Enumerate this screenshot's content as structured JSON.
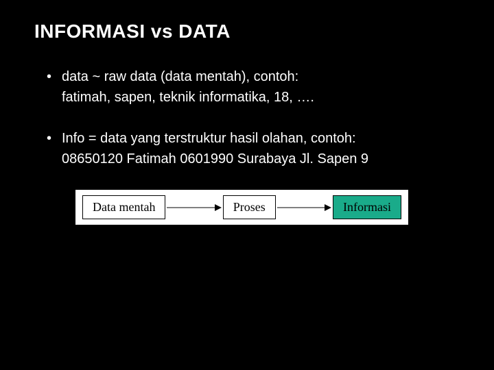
{
  "slide": {
    "title": "INFORMASI vs DATA",
    "bullets": [
      {
        "line1": "data ~ raw data (data mentah), contoh:",
        "line2": "fatimah, sapen, teknik informatika, 18, …."
      },
      {
        "line1": "Info = data yang terstruktur hasil olahan, contoh:",
        "line2": "08650120 Fatimah 0601990 Surabaya Jl. Sapen 9"
      }
    ],
    "diagram": {
      "box1": "Data mentah",
      "box2": "Proses",
      "box3": "Informasi"
    }
  }
}
